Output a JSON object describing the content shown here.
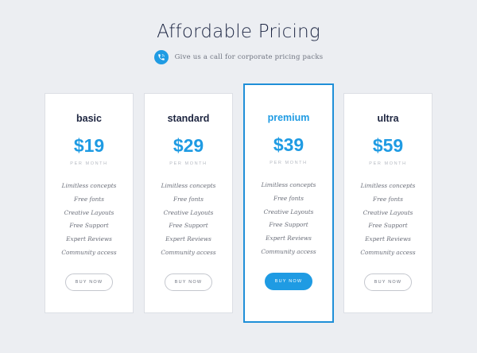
{
  "header": {
    "title": "Affordable Pricing",
    "subline": "Give us a call for corporate pricing packs",
    "icon": "phone-icon"
  },
  "accent_color": "#1f9be3",
  "plans": [
    {
      "name": "basic",
      "price": "$19",
      "period": "PER MONTH",
      "features": [
        "Limitless concepts",
        "Free fonts",
        "Creative Layouts",
        "Free Support",
        "Expert Reviews",
        "Community access"
      ],
      "button": "BUY NOW"
    },
    {
      "name": "standard",
      "price": "$29",
      "period": "PER MONTH",
      "features": [
        "Limitless concepts",
        "Free fonts",
        "Creative Layouts",
        "Free Support",
        "Expert Reviews",
        "Community access"
      ],
      "button": "BUY NOW"
    },
    {
      "name": "premium",
      "price": "$39",
      "period": "PER MONTH",
      "features": [
        "Limitless concepts",
        "Free fonts",
        "Creative Layouts",
        "Free Support",
        "Expert Reviews",
        "Community access"
      ],
      "button": "BUY NOW"
    },
    {
      "name": "ultra",
      "price": "$59",
      "period": "PER MONTH",
      "features": [
        "Limitless concepts",
        "Free fonts",
        "Creative Layouts",
        "Free Support",
        "Expert Reviews",
        "Community access"
      ],
      "button": "BUY NOW"
    }
  ]
}
